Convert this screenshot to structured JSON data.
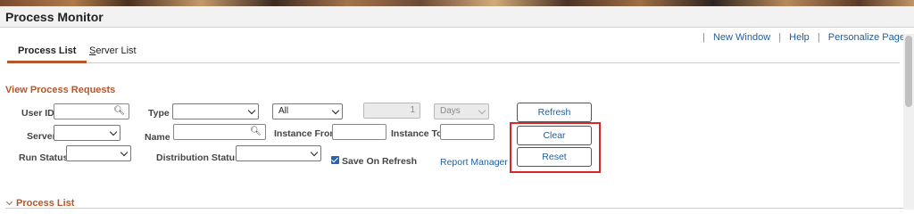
{
  "page": {
    "title": "Process Monitor"
  },
  "links": {
    "new_window": "New Window",
    "help": "Help",
    "personalize": "Personalize Page",
    "sep": "|"
  },
  "tabs": [
    {
      "label": "Process List"
    },
    {
      "label_first": "S",
      "label_rest": "erver List"
    }
  ],
  "filter": {
    "section_title": "View Process Requests",
    "user_id_label": "User ID",
    "type_label": "Type",
    "type_value": "",
    "all_value": "All",
    "days_number": "1",
    "days_unit": "Days",
    "server_label": "Server",
    "server_value": "",
    "name_label": "Name",
    "instance_from_label": "Instance From",
    "instance_to_label": "Instance To",
    "run_status_label": "Run Status",
    "run_status_value": "",
    "dist_status_label": "Distribution Status",
    "dist_status_value": "",
    "save_on_refresh_label": "Save On Refresh",
    "save_on_refresh_checked": true,
    "report_manager_label": "Report Manager"
  },
  "buttons": {
    "refresh": "Refresh",
    "clear": "Clear",
    "reset": "Reset"
  },
  "process_list": {
    "title": "Process List"
  },
  "icons": {
    "search": "search-icon",
    "dropdown": "chevron-down-icon",
    "collapse": "chevron-down-icon"
  },
  "colors": {
    "section_accent": "#b5572b",
    "link": "#1f5fa0",
    "highlight": "#d8262b"
  }
}
